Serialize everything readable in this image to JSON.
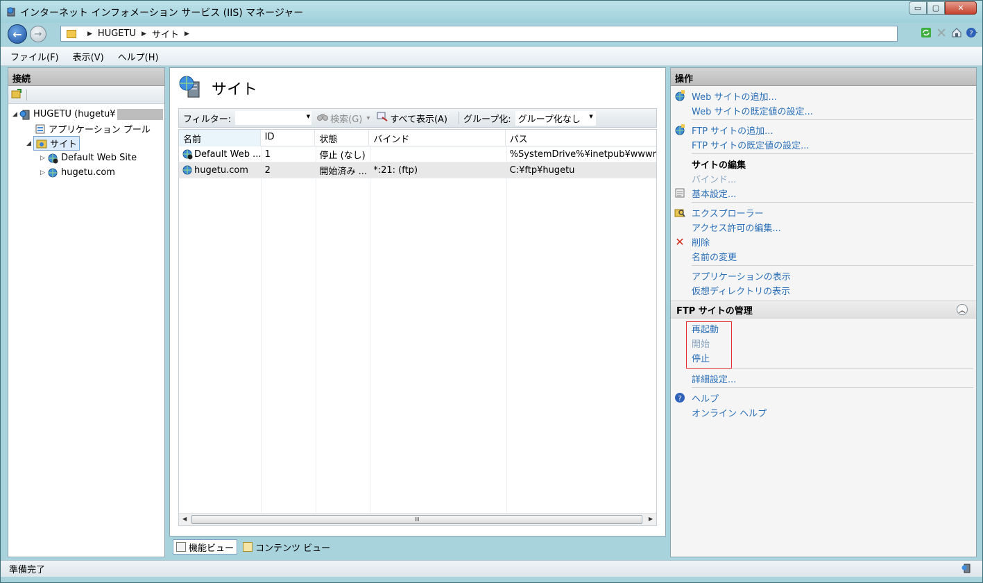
{
  "window": {
    "title": "インターネット インフォメーション サービス (IIS) マネージャー",
    "controls": {
      "minimize": "▭",
      "maximize": "▢",
      "close": "✕"
    }
  },
  "address": {
    "crumbs": [
      "HUGETU",
      "サイト"
    ]
  },
  "menu": [
    "ファイル(F)",
    "表示(V)",
    "ヘルプ(H)"
  ],
  "connections": {
    "header": "接続",
    "tree": {
      "server": "HUGETU (hugetu¥",
      "app_pools": "アプリケーション プール",
      "sites": "サイト",
      "site_children": [
        "Default Web Site",
        "hugetu.com"
      ]
    }
  },
  "center": {
    "title": "サイト",
    "filter": {
      "label": "フィルター:",
      "search": "検索(G)",
      "show_all": "すべて表示(A)",
      "group_label": "グループ化:",
      "group_value": "グループ化なし"
    },
    "columns": [
      "名前",
      "ID",
      "状態",
      "バインド",
      "パス"
    ],
    "rows": [
      {
        "name": "Default Web ...",
        "id": "1",
        "status": "停止 (なし)",
        "binding": "",
        "path": "%SystemDrive%¥inetpub¥wwwroot"
      },
      {
        "name": "hugetu.com",
        "id": "2",
        "status": "開始済み ...",
        "binding": "*:21: (ftp)",
        "path": "C:¥ftp¥hugetu"
      }
    ],
    "scroll_thumb": "III",
    "tabs": [
      "機能ビュー",
      "コンテンツ ビュー"
    ]
  },
  "actions": {
    "header": "操作",
    "add_web": "Web サイトの追加...",
    "web_defaults": "Web サイトの既定値の設定...",
    "add_ftp": "FTP サイトの追加...",
    "ftp_defaults": "FTP サイトの既定値の設定...",
    "edit_site_head": "サイトの編集",
    "bindings": "バインド...",
    "basic_settings": "基本設定...",
    "explore": "エクスプローラー",
    "edit_permissions": "アクセス許可の編集...",
    "remove": "削除",
    "rename": "名前の変更",
    "view_apps": "アプリケーションの表示",
    "view_vdirs": "仮想ディレクトリの表示",
    "ftp_manage_head": "FTP サイトの管理",
    "restart": "再起動",
    "start": "開始",
    "stop": "停止",
    "advanced": "詳細設定...",
    "help": "ヘルプ",
    "online_help": "オンライン ヘルプ"
  },
  "status": {
    "text": "準備完了"
  },
  "colors": {
    "link": "#2a6fb8",
    "highlight_box": "#e03030",
    "header_gray": "#c8c8c8"
  }
}
